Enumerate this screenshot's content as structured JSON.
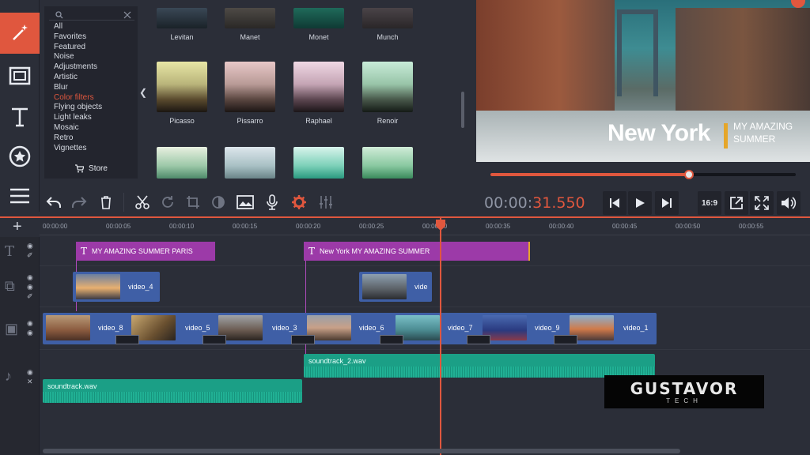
{
  "colors": {
    "accent": "#e0573e",
    "title_clip": "#9c3aa8",
    "video_clip": "#3f5fa6",
    "audio_clip": "#1b9f86",
    "bg": "#2b2e38"
  },
  "sidebar": {
    "tools": [
      "magic-wand-icon",
      "film-strip-icon",
      "text-icon",
      "star-badge-icon",
      "list-icon"
    ],
    "active": 0
  },
  "categories": {
    "search_placeholder": "",
    "items": [
      "All",
      "Favorites",
      "Featured",
      "Noise",
      "Adjustments",
      "Artistic",
      "Blur",
      "Color filters",
      "Flying objects",
      "Light leaks",
      "Mosaic",
      "Retro",
      "Vignettes"
    ],
    "selected": "Color filters",
    "store_label": "Store"
  },
  "filters": {
    "row1": [
      "Levitan",
      "Manet",
      "Monet",
      "Munch"
    ],
    "row2": [
      "Picasso",
      "Pissarro",
      "Raphael",
      "Renoir"
    ]
  },
  "preview": {
    "title": "New York",
    "subtitle_1": "MY AMAZING",
    "subtitle_2": "SUMMER",
    "progress": 0.65
  },
  "player": {
    "timecode_dim": "00:00:",
    "timecode_hi": "31.550",
    "aspect": "16:9"
  },
  "ruler": [
    "00:00:00",
    "00:00:05",
    "00:00:10",
    "00:00:15",
    "00:00:20",
    "00:00:25",
    "00:00:30",
    "00:00:35",
    "00:00:40",
    "00:00:45",
    "00:00:50",
    "00:00:55"
  ],
  "timeline": {
    "titles": [
      "MY AMAZING SUMMER PARIS",
      "New York MY AMAZING SUMMER"
    ],
    "overlay_clips": [
      "video_4",
      "vide"
    ],
    "main_clips": [
      "video_8",
      "video_5",
      "video_3",
      "video_6",
      "video_7",
      "video_9",
      "video_1"
    ],
    "audio": [
      "soundtrack_2.wav",
      "soundtrack.wav"
    ]
  },
  "watermark": {
    "main": "GUSTAVOR",
    "sub": "TECH"
  }
}
